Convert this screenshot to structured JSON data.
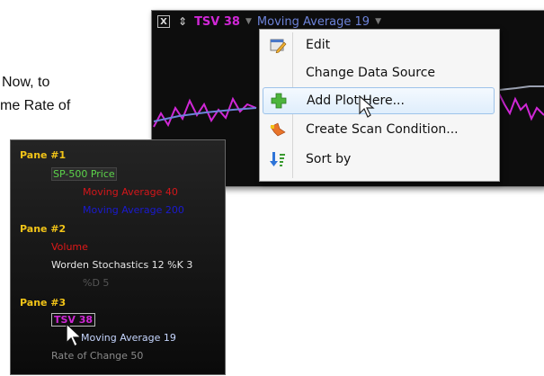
{
  "doc": {
    "line1": "Now, to",
    "line2": "me Rate of"
  },
  "chart": {
    "close_label": "X",
    "updown_glyph": "⇕",
    "plot_name": "TSV 38",
    "dropdown_glyph": "▼",
    "indicator_name": "Moving Average 19",
    "indicator_color": "#6c82d8",
    "plot_color": "#d027d6"
  },
  "menu": {
    "items": [
      {
        "label": "Edit",
        "icon": "edit-icon"
      },
      {
        "label": "Change Data Source",
        "icon": ""
      },
      {
        "label": "Add Plot Here...",
        "icon": "add-plot-icon"
      },
      {
        "label": "Create Scan Condition...",
        "icon": "scan-icon"
      },
      {
        "label": "Sort by",
        "icon": "sort-icon"
      }
    ],
    "highlight_color": "#dfeefc"
  },
  "panes": {
    "pane1": {
      "header": "Pane #1",
      "price": "SP-500 Price",
      "ma40": "Moving Average 40",
      "ma200": "Moving Average 200"
    },
    "pane2": {
      "header": "Pane #2",
      "volume": "Volume",
      "stoch": "Worden Stochastics 12 %K 3",
      "pd": "%D 5"
    },
    "pane3": {
      "header": "Pane #3",
      "tsv": "TSV 38",
      "ma19": "Moving Average 19",
      "roc": "Rate of Change 50"
    },
    "colors": {
      "header": "#f2c418",
      "price": "#5cd44a",
      "ma40": "#d4161a",
      "ma200": "#1a1ad0",
      "volume": "#e01818",
      "stoch": "#e6e6e6",
      "pd": "#555555",
      "tsv": "#d027d6",
      "ma19": "#c6d6ff",
      "roc": "#8a8a8a"
    }
  }
}
